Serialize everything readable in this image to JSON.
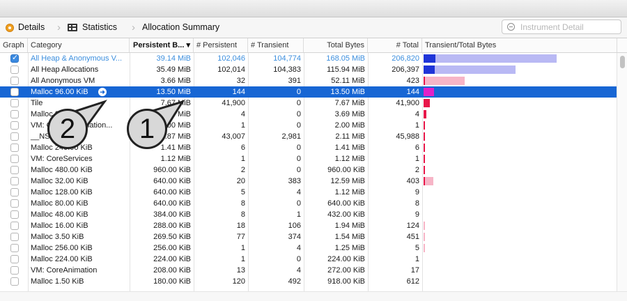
{
  "jumpbar": {
    "crumbs": [
      "Details",
      "Statistics",
      "Allocation Summary"
    ],
    "search_placeholder": "Instrument Detail"
  },
  "columns": [
    "Graph",
    "Category",
    "Persistent B...",
    "# Persistent",
    "# Transient",
    "Total Bytes",
    "# Total",
    "Transient/Total Bytes"
  ],
  "sorted_column": "Persistent B...",
  "sort_indicator": "▾",
  "selected_row": 3,
  "colors": {
    "selection": "#1766d4",
    "persistent_dark": "#1f35d8",
    "transient_light": "#b9b9f4",
    "persistent_red": "#e8174a",
    "transient_pink": "#f7b5c7",
    "selected_persistent": "#e020c8"
  },
  "rows": [
    {
      "graph": true,
      "category": "All Heap & Anonymous V...",
      "persistent_bytes": "39.14 MiB",
      "n_persistent": "102,046",
      "n_transient": "104,774",
      "total_bytes": "168.05 MiB",
      "n_total": "206,820",
      "persistent_fraction": 0.073,
      "total_fraction": 0.81,
      "style": "summary"
    },
    {
      "graph": false,
      "category": "All Heap Allocations",
      "persistent_bytes": "35.49 MiB",
      "n_persistent": "102,014",
      "n_transient": "104,383",
      "total_bytes": "115.94 MiB",
      "n_total": "206,397",
      "persistent_fraction": 0.066,
      "total_fraction": 0.56,
      "style": "heap"
    },
    {
      "graph": false,
      "category": "All Anonymous VM",
      "persistent_bytes": "3.66 MiB",
      "n_persistent": "32",
      "n_transient": "391",
      "total_bytes": "52.11 MiB",
      "n_total": "423",
      "persistent_fraction": 0.007,
      "total_fraction": 0.25,
      "style": "vm"
    },
    {
      "graph": false,
      "category": "Malloc 96.00 KiB",
      "persistent_bytes": "13.50 MiB",
      "n_persistent": "144",
      "n_transient": "0",
      "total_bytes": "13.50 MiB",
      "n_total": "144",
      "persistent_fraction": 0.065,
      "total_fraction": 0.065,
      "style": "selected"
    },
    {
      "graph": false,
      "category": "Tile",
      "persistent_bytes": "7.67 MiB",
      "n_persistent": "41,900",
      "n_transient": "0",
      "total_bytes": "7.67 MiB",
      "n_total": "41,900",
      "persistent_fraction": 0.037,
      "total_fraction": 0.037,
      "style": "red"
    },
    {
      "graph": false,
      "category": "Malloc 96.00 KiB",
      "persistent_bytes": "3.69 MiB",
      "n_persistent": "4",
      "n_transient": "0",
      "total_bytes": "3.69 MiB",
      "n_total": "4",
      "persistent_fraction": 0.018,
      "total_fraction": 0.018,
      "style": "red"
    },
    {
      "graph": false,
      "category": "VM: CoreContinuation...",
      "persistent_bytes": "2.00 MiB",
      "n_persistent": "1",
      "n_transient": "0",
      "total_bytes": "2.00 MiB",
      "n_total": "1",
      "persistent_fraction": 0.01,
      "total_fraction": 0.01,
      "style": "red"
    },
    {
      "graph": false,
      "category": "__NSCFString",
      "persistent_bytes": "1.87 MiB",
      "n_persistent": "43,007",
      "n_transient": "2,981",
      "total_bytes": "2.11 MiB",
      "n_total": "45,988",
      "persistent_fraction": 0.009,
      "total_fraction": 0.01,
      "style": "red"
    },
    {
      "graph": false,
      "category": "Malloc 240.00 KiB",
      "persistent_bytes": "1.41 MiB",
      "n_persistent": "6",
      "n_transient": "0",
      "total_bytes": "1.41 MiB",
      "n_total": "6",
      "persistent_fraction": 0.007,
      "total_fraction": 0.007,
      "style": "red"
    },
    {
      "graph": false,
      "category": "VM: CoreServices",
      "persistent_bytes": "1.12 MiB",
      "n_persistent": "1",
      "n_transient": "0",
      "total_bytes": "1.12 MiB",
      "n_total": "1",
      "persistent_fraction": 0.005,
      "total_fraction": 0.005,
      "style": "red"
    },
    {
      "graph": false,
      "category": "Malloc 480.00 KiB",
      "persistent_bytes": "960.00 KiB",
      "n_persistent": "2",
      "n_transient": "0",
      "total_bytes": "960.00 KiB",
      "n_total": "2",
      "persistent_fraction": 0.005,
      "total_fraction": 0.005,
      "style": "red"
    },
    {
      "graph": false,
      "category": "Malloc 32.00 KiB",
      "persistent_bytes": "640.00 KiB",
      "n_persistent": "20",
      "n_transient": "383",
      "total_bytes": "12.59 MiB",
      "n_total": "403",
      "persistent_fraction": 0.003,
      "total_fraction": 0.06,
      "style": "red"
    },
    {
      "graph": false,
      "category": "Malloc 128.00 KiB",
      "persistent_bytes": "640.00 KiB",
      "n_persistent": "5",
      "n_transient": "4",
      "total_bytes": "1.12 MiB",
      "n_total": "9",
      "persistent_fraction": 0,
      "total_fraction": 0,
      "style": "none"
    },
    {
      "graph": false,
      "category": "Malloc 80.00 KiB",
      "persistent_bytes": "640.00 KiB",
      "n_persistent": "8",
      "n_transient": "0",
      "total_bytes": "640.00 KiB",
      "n_total": "8",
      "persistent_fraction": 0,
      "total_fraction": 0,
      "style": "none"
    },
    {
      "graph": false,
      "category": "Malloc 48.00 KiB",
      "persistent_bytes": "384.00 KiB",
      "n_persistent": "8",
      "n_transient": "1",
      "total_bytes": "432.00 KiB",
      "n_total": "9",
      "persistent_fraction": 0,
      "total_fraction": 0,
      "style": "none"
    },
    {
      "graph": false,
      "category": "Malloc 16.00 KiB",
      "persistent_bytes": "288.00 KiB",
      "n_persistent": "18",
      "n_transient": "106",
      "total_bytes": "1.94 MiB",
      "n_total": "124",
      "persistent_fraction": 0,
      "total_fraction": 0.006,
      "style": "pink"
    },
    {
      "graph": false,
      "category": "Malloc 3.50 KiB",
      "persistent_bytes": "269.50 KiB",
      "n_persistent": "77",
      "n_transient": "374",
      "total_bytes": "1.54 MiB",
      "n_total": "451",
      "persistent_fraction": 0,
      "total_fraction": 0.006,
      "style": "pink"
    },
    {
      "graph": false,
      "category": "Malloc 256.00 KiB",
      "persistent_bytes": "256.00 KiB",
      "n_persistent": "1",
      "n_transient": "4",
      "total_bytes": "1.25 MiB",
      "n_total": "5",
      "persistent_fraction": 0,
      "total_fraction": 0.006,
      "style": "pink"
    },
    {
      "graph": false,
      "category": "Malloc 224.00 KiB",
      "persistent_bytes": "224.00 KiB",
      "n_persistent": "1",
      "n_transient": "0",
      "total_bytes": "224.00 KiB",
      "n_total": "1",
      "persistent_fraction": 0,
      "total_fraction": 0,
      "style": "none"
    },
    {
      "graph": false,
      "category": "VM: CoreAnimation",
      "persistent_bytes": "208.00 KiB",
      "n_persistent": "13",
      "n_transient": "4",
      "total_bytes": "272.00 KiB",
      "n_total": "17",
      "persistent_fraction": 0,
      "total_fraction": 0,
      "style": "none"
    },
    {
      "graph": false,
      "category": "Malloc 1.50 KiB",
      "persistent_bytes": "180.00 KiB",
      "n_persistent": "120",
      "n_transient": "492",
      "total_bytes": "918.00 KiB",
      "n_total": "612",
      "persistent_fraction": 0,
      "total_fraction": 0,
      "style": "none"
    }
  ],
  "callouts": [
    "2",
    "1"
  ]
}
